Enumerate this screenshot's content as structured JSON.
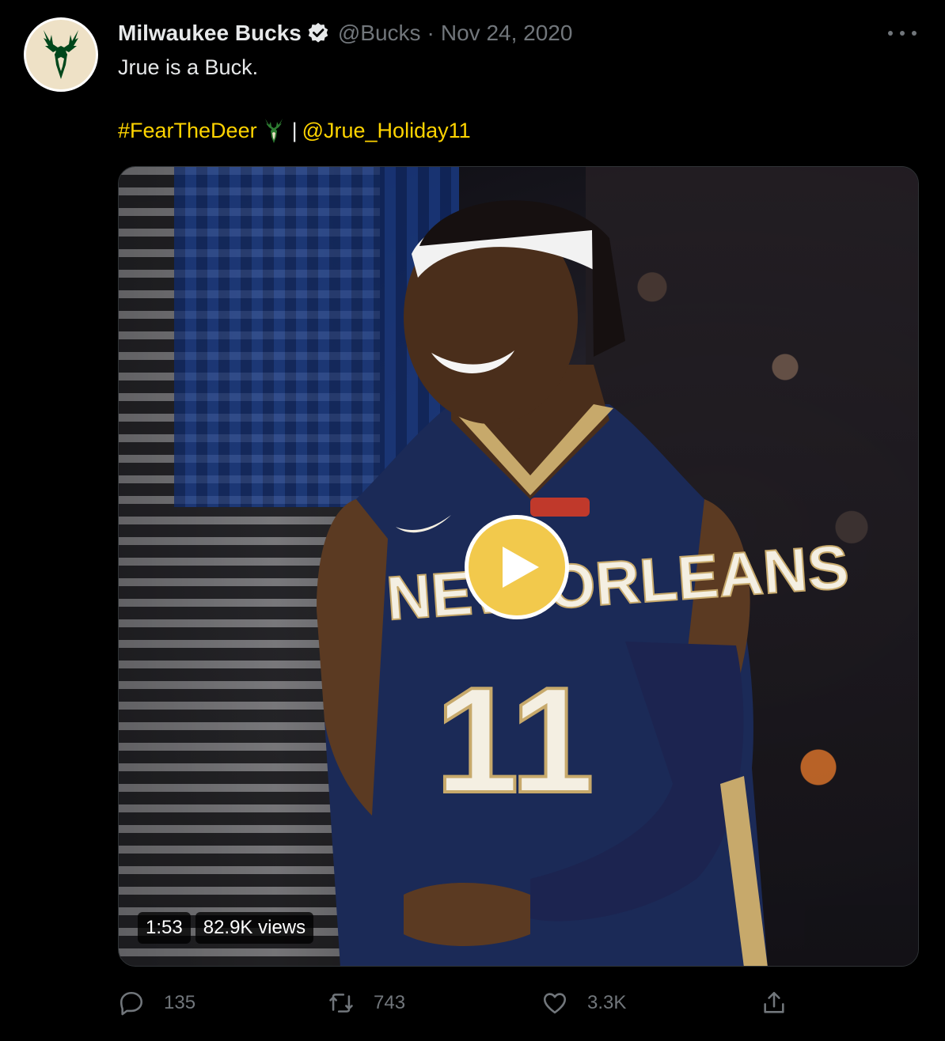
{
  "tweet": {
    "author_name": "Milwaukee Bucks",
    "handle": "@Bucks",
    "separator": "·",
    "date": "Nov 24, 2020",
    "text": "Jrue is a Buck.",
    "hashtag": "#FearTheDeer",
    "divider": "|",
    "mention": "@Jrue_Holiday11"
  },
  "media": {
    "duration": "1:53",
    "views": "82.9K views"
  },
  "actions": {
    "reply_count": "135",
    "retweet_count": "743",
    "like_count": "3.3K"
  },
  "colors": {
    "background": "#000000",
    "text": "#e7e9ea",
    "muted": "#71767b",
    "link": "#ffd400",
    "bucks_green": "#00471b",
    "bucks_cream": "#eee1c6",
    "play_yellow": "#f2c94c"
  },
  "icons": {
    "avatar": "bucks-deer-logo",
    "verified": "verified-badge-icon",
    "more": "more-dots-icon",
    "emoji": "deer-emoji-icon",
    "play": "play-icon",
    "reply": "reply-icon",
    "retweet": "retweet-icon",
    "like": "heart-icon",
    "share": "share-icon"
  }
}
